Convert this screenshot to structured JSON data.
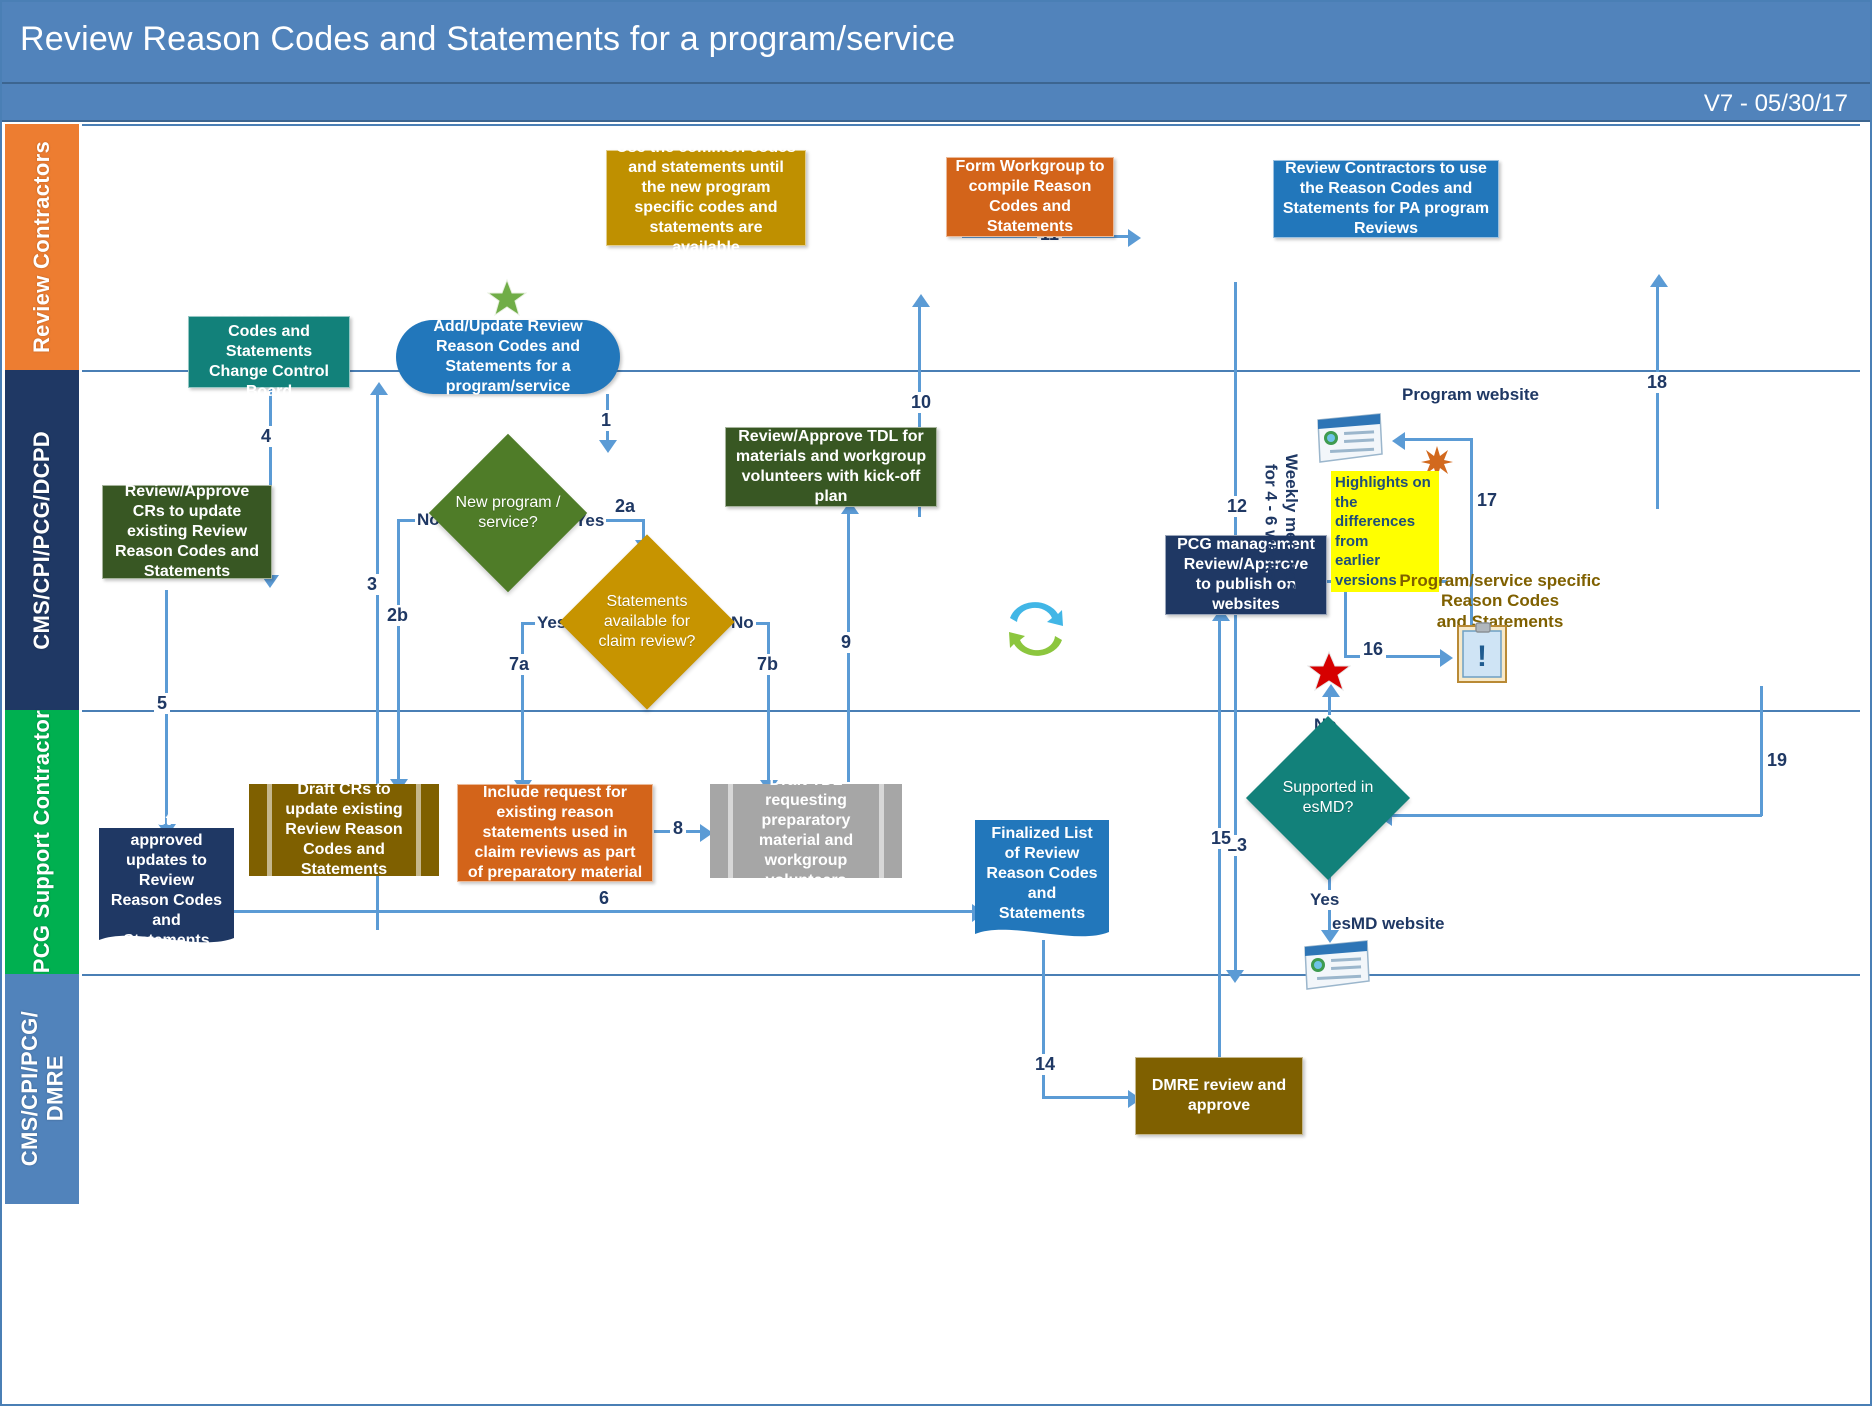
{
  "header": {
    "title": "Review Reason Codes and Statements for a program/service",
    "version": "V7 - 05/30/17"
  },
  "lanes": [
    {
      "id": "review-contractors",
      "label": "Review Contractors",
      "color": "#ed7d31"
    },
    {
      "id": "cms-cpi-pcg-dcpd",
      "label": "CMS/CPI/PCG/DCPD",
      "color": "#1f3864"
    },
    {
      "id": "pcg-support-contractor",
      "label": "PCG Support Contractor",
      "color": "#00b050"
    },
    {
      "id": "cms-cpi-pcg-dmre",
      "label": "CMS/CPI/PCG/\nDMRE",
      "color": "#5183bb"
    }
  ],
  "nodes": {
    "use_common_codes": "Use the common codes and statements until the new program specific codes and statements are available",
    "form_workgroup": "Form Workgroup to compile Reason Codes and Statements",
    "review_contractors_use": "Review Contractors to use the Reason Codes and Statements for PA program Reviews",
    "ccb": "Review Reason Codes and Statements Change Control Board",
    "start": "Add/Update Review Reason Codes and Statements for a program/service",
    "review_approve_crs": "Review/Approve CRs to update existing Review Reason Codes and Statements",
    "review_approve_tdl": "Review/Approve TDL for materials and workgroup volunteers with kick-off plan",
    "pcg_management": "PCG management Review/Approve to publish on websites",
    "list_of_approved": "List of approved updates to Review Reason Codes and Statements",
    "draft_crs": "Draft CRs to update existing Review Reason Codes and Statements",
    "include_request": "Include request for existing reason statements used in claim reviews as part of preparatory material",
    "draft_tdl": "Draft TDL requesting preparatory material and workgroup volunteers",
    "finalized_list": "Finalized List of Review Reason Codes and Statements",
    "dmre_review": "DMRE review and approve"
  },
  "decisions": {
    "new_program": "New program / service?",
    "statements_available": "Statements available for claim review?",
    "supported_esmd": "Supported in esMD?"
  },
  "annotations": {
    "program_website": "Program website",
    "esmd_website": "esMD website",
    "weekly_meetings": "Weekly meetings\nfor 4 - 6 weeks",
    "program_specific": "Program/service specific\nReason Codes\nand Statements",
    "highlights": "Highlights on the\ndifferences from\nearlier versions"
  },
  "steps": {
    "s1": "1",
    "s2a": "2a",
    "s2b": "2b",
    "s3": "3",
    "s4": "4",
    "s5": "5",
    "s6": "6",
    "s7a": "7a",
    "s7b": "7b",
    "s8": "8",
    "s9": "9",
    "s10": "10",
    "s11": "11",
    "s12": "12",
    "s13": "13",
    "s14": "14",
    "s15": "15",
    "s16": "16",
    "s17": "17",
    "s18": "18",
    "s19": "19"
  },
  "branch_labels": {
    "new_program_no": "No",
    "new_program_yes": "Yes",
    "statements_yes": "Yes",
    "statements_no": "No",
    "esmd_no": "No",
    "esmd_yes": "Yes"
  },
  "icons": {
    "green_star": "green-star-icon",
    "red_star": "red-star-icon",
    "recycle": "recycle-loop-icon",
    "burst": "orange-burst-icon",
    "program_website": "website-window-icon",
    "esmd_website": "website-window-icon",
    "clipboard": "clipboard-document-icon"
  },
  "colors": {
    "header": "#5183bb",
    "lane_review_contractors": "#ed7d31",
    "lane_dcpd": "#1f3864",
    "lane_pcg": "#00b050",
    "lane_dmre": "#5183bb",
    "connector": "#5b9bd5",
    "gold": "#bf9000",
    "orange": "#d3641a",
    "blue": "#2277bb",
    "teal": "#12817a",
    "dark_green": "#385723",
    "navy": "#1f3864",
    "grey": "#a6a6a6",
    "highlight": "#ffff00"
  }
}
